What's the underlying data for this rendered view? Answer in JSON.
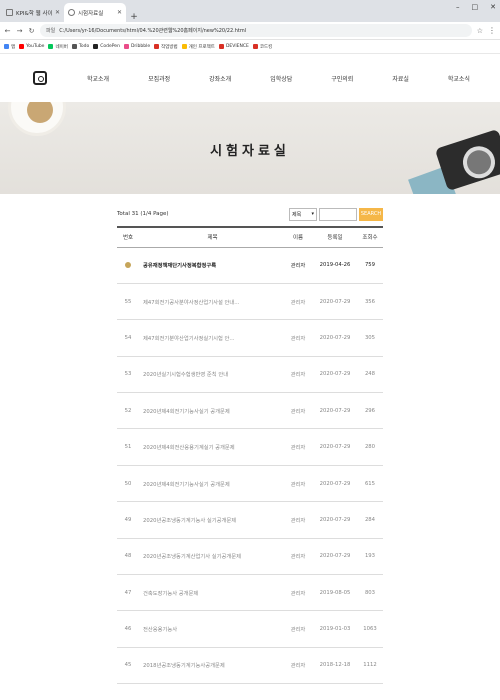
{
  "browser": {
    "tabs": [
      {
        "label": "KPI&학 웹 사이트",
        "active": false
      },
      {
        "label": "시험자료실",
        "active": true
      }
    ],
    "new_tab": "+",
    "url_prefix": "파일",
    "url": "C:/Users/yr-16/Documents/html/04.%20관련웹%20홈페이지/new%20/22.html",
    "bookmarks": [
      {
        "label": "앱",
        "color": "#4285f4"
      },
      {
        "label": "YouTube",
        "color": "#ff0000"
      },
      {
        "label": "네이버",
        "color": "#03c75a"
      },
      {
        "label": "Todo",
        "color": "#555555"
      },
      {
        "label": "CodePen",
        "color": "#222222"
      },
      {
        "label": "Dribbble",
        "color": "#ea4c89"
      },
      {
        "label": "작업방법",
        "color": "#d93025"
      },
      {
        "label": "개인 프로젝트",
        "color": "#fbbc04"
      },
      {
        "label": "DEVIENCE",
        "color": "#d93025"
      },
      {
        "label": "코드킹",
        "color": "#d93025"
      }
    ]
  },
  "header": {
    "nav": [
      "학교소개",
      "모집과정",
      "강좌소개",
      "입학상담",
      "구인의뢰",
      "자료실",
      "학교소식"
    ]
  },
  "hero": {
    "title": "시험자료실"
  },
  "board": {
    "total": "Total 31 (1/4 Page)",
    "search_select": "제목",
    "search_button": "SEARCH",
    "headers": {
      "no": "번호",
      "title": "제목",
      "writer": "이름",
      "date": "등록일",
      "hits": "조회수"
    },
    "rows": [
      {
        "no": "",
        "title": "공유재정책재단기사정복합정구록",
        "writer": "관리자",
        "date": "2019-04-26",
        "hits": "759",
        "notice": true
      },
      {
        "no": "55",
        "title": "제47회전기공사분야사정산업기사설 안내...",
        "writer": "관리자",
        "date": "2020-07-29",
        "hits": "356",
        "notice": false
      },
      {
        "no": "54",
        "title": "제47회전기분야산업기사정실기시험 안...",
        "writer": "관리자",
        "date": "2020-07-29",
        "hits": "305",
        "notice": false
      },
      {
        "no": "53",
        "title": "2020년실기시험수험생반영 준칙 안내",
        "writer": "관리자",
        "date": "2020-07-29",
        "hits": "248",
        "notice": false
      },
      {
        "no": "52",
        "title": "2020년제4회전기기능사실기 공개문제",
        "writer": "관리자",
        "date": "2020-07-29",
        "hits": "296",
        "notice": false
      },
      {
        "no": "51",
        "title": "2020년제4회전산응용기계실기 공개문제",
        "writer": "관리자",
        "date": "2020-07-29",
        "hits": "280",
        "notice": false
      },
      {
        "no": "50",
        "title": "2020년제4회전기기능사실기 공개문제",
        "writer": "관리자",
        "date": "2020-07-29",
        "hits": "615",
        "notice": false
      },
      {
        "no": "49",
        "title": "2020년공조냉동기계기능사 실기공개문제",
        "writer": "관리자",
        "date": "2020-07-29",
        "hits": "284",
        "notice": false
      },
      {
        "no": "48",
        "title": "2020년공조냉동기계산업기사 실기공개문제",
        "writer": "관리자",
        "date": "2020-07-29",
        "hits": "193",
        "notice": false
      },
      {
        "no": "47",
        "title": "건축도장기능사 공개문제",
        "writer": "관리자",
        "date": "2019-08-05",
        "hits": "803",
        "notice": false
      },
      {
        "no": "46",
        "title": "전산응용기능사",
        "writer": "관리자",
        "date": "2019-01-03",
        "hits": "1063",
        "notice": false
      },
      {
        "no": "45",
        "title": "2018년공조냉동기계기능사공개문제",
        "writer": "관리자",
        "date": "2018-12-18",
        "hits": "1112",
        "notice": false
      }
    ]
  }
}
